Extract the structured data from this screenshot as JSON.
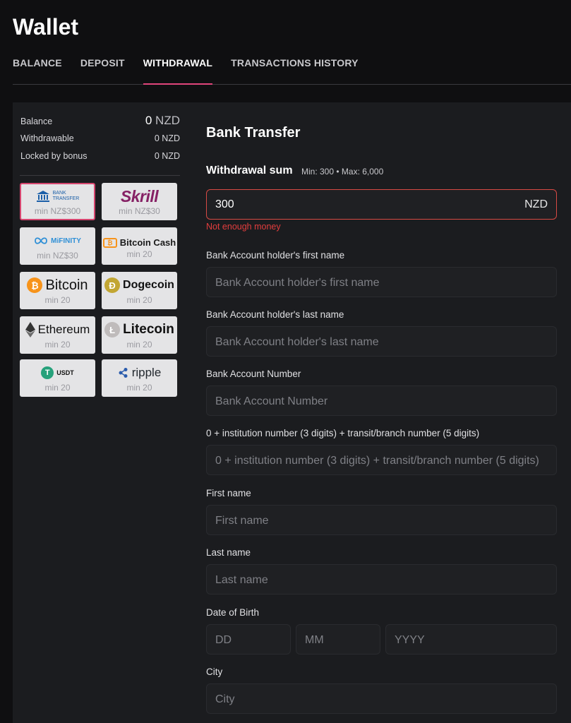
{
  "page": {
    "title": "Wallet"
  },
  "tabs": [
    "BALANCE",
    "DEPOSIT",
    "WITHDRAWAL",
    "TRANSACTIONS HISTORY"
  ],
  "balance": {
    "balance_label": "Balance",
    "balance_value": "0",
    "balance_currency": "NZD",
    "withdrawable_label": "Withdrawable",
    "withdrawable_value": "0 NZD",
    "locked_label": "Locked by bonus",
    "locked_value": "0 NZD"
  },
  "methods": [
    {
      "id": "bank-transfer",
      "logo_line1": "BANK",
      "logo_line2": "TRANSFER",
      "min": "min NZ$300",
      "selected": true
    },
    {
      "id": "skrill",
      "logo": "Skrill",
      "min": "min NZ$30"
    },
    {
      "id": "mifinity",
      "logo": "MiFINITY",
      "min": "min NZ$30"
    },
    {
      "id": "bitcoin-cash",
      "logo": "Bitcoin Cash",
      "min": "min 20"
    },
    {
      "id": "bitcoin",
      "logo": "Bitcoin",
      "min": "min 20"
    },
    {
      "id": "dogecoin",
      "logo": "Dogecoin",
      "min": "min 20"
    },
    {
      "id": "ethereum",
      "logo": "Ethereum",
      "min": "min 20"
    },
    {
      "id": "litecoin",
      "logo": "Litecoin",
      "min": "min 20"
    },
    {
      "id": "usdt",
      "logo": "USDT",
      "min": "min 20"
    },
    {
      "id": "ripple",
      "logo": "ripple",
      "min": "min 20"
    }
  ],
  "form": {
    "title": "Bank Transfer",
    "sum_label": "Withdrawal sum",
    "sum_limits": "Min: 300 • Max: 6,000",
    "sum_value": "300",
    "sum_currency": "NZD",
    "error": "Not enough money",
    "fields": [
      {
        "label": "Bank Account holder's first name",
        "placeholder": "Bank Account holder's first name"
      },
      {
        "label": "Bank Account holder's last name",
        "placeholder": "Bank Account holder's last name"
      },
      {
        "label": "Bank Account Number",
        "placeholder": "Bank Account Number"
      },
      {
        "label": "0 + institution number (3 digits) + transit/branch number (5 digits)",
        "placeholder": "0 + institution number (3 digits) + transit/branch number (5 digits)"
      },
      {
        "label": "First name",
        "placeholder": "First name"
      },
      {
        "label": "Last name",
        "placeholder": "Last name"
      }
    ],
    "dob_label": "Date of Birth",
    "dob": {
      "dd": "DD",
      "mm": "MM",
      "yyyy": "YYYY"
    },
    "city_label": "City",
    "city_placeholder": "City"
  },
  "colors": {
    "accent": "#e0457b",
    "error": "#e23d3d",
    "skrill": "#862165",
    "bitcoin": "#f7931a",
    "dogecoin": "#c2a633",
    "litecoin": "#bfbbbb",
    "usdt": "#26a17b",
    "ripple": "#23292f"
  }
}
